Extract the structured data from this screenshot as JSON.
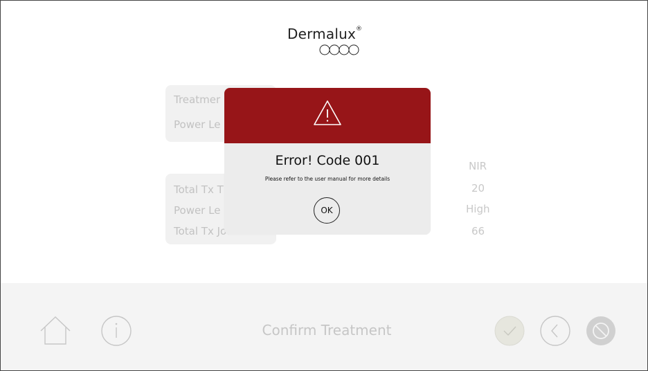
{
  "logo": {
    "text": "Dermalux",
    "mark": "®"
  },
  "background": {
    "top_labels": [
      "Treatmer",
      "Power Le"
    ],
    "bottom_labels": [
      "Total Tx T",
      "Power Le",
      "Total Tx Jo"
    ],
    "values": [
      "NIR",
      "20",
      "High",
      "66"
    ]
  },
  "modal": {
    "title": "Error! Code 001",
    "message": "Please refer to the user manual for more details",
    "ok_label": "OK",
    "header_color": "#971518"
  },
  "bottom_bar": {
    "title": "Confirm Treatment",
    "icons": [
      "home-icon",
      "info-icon",
      "confirm-check-icon",
      "back-icon",
      "cancel-icon"
    ]
  }
}
